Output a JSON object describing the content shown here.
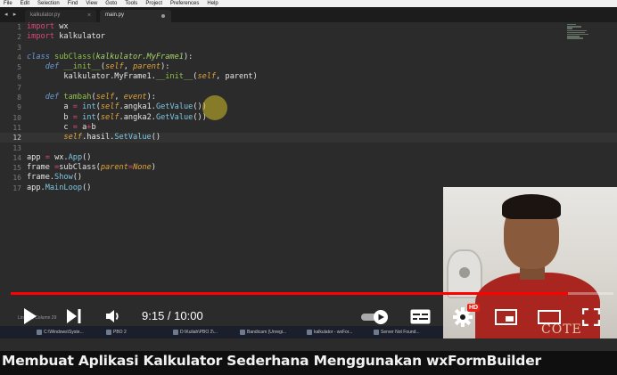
{
  "menu": [
    "File",
    "Edit",
    "Selection",
    "Find",
    "View",
    "Goto",
    "Tools",
    "Project",
    "Preferences",
    "Help"
  ],
  "tabs": [
    {
      "label": "kalkulator.py",
      "close": "×"
    },
    {
      "label": "main.py"
    }
  ],
  "nav_arrows": "◂ ▸",
  "line_numbers": [
    "1",
    "2",
    "3",
    "4",
    "5",
    "6",
    "7",
    "8",
    "9",
    "10",
    "11",
    "12",
    "13",
    "14",
    "15",
    "16",
    "17"
  ],
  "current_line": "12",
  "code": {
    "l1_kw": "import",
    "l1_rest": " wx",
    "l2_kw": "import",
    "l2_rest": " kalkulator",
    "l4_kw": "class",
    "l4_name": " subClass(",
    "l4_base": "kalkulator.MyFrame1",
    "l4_end": "):",
    "l5_indent": "    ",
    "l5_kw": "def",
    "l5_fn": " __init__",
    "l5_p1": "(",
    "l5_self": "self",
    "l5_comma": ", ",
    "l5_parent": "parent",
    "l5_end": "):",
    "l6_text": "        kalkulator.MyFrame1.",
    "l6_fn": "__init__",
    "l6_p1": "(",
    "l6_self": "self",
    "l6_end": ", parent)",
    "l8_indent": "    ",
    "l8_kw": "def",
    "l8_fn": " tambah",
    "l8_p1": "(",
    "l8_self": "self",
    "l8_comma": ", ",
    "l8_event": "event",
    "l8_end": "):",
    "l9_a": "        a ",
    "l9_eq": "=",
    "l9_sp": " ",
    "l9_int": "int",
    "l9_p": "(",
    "l9_self": "self",
    "l9_dot": ".angka1.",
    "l9_gv": "GetValue",
    "l9_end": "())",
    "l10_a": "        b ",
    "l10_eq": "=",
    "l10_sp": " ",
    "l10_int": "int",
    "l10_p": "(",
    "l10_self": "self",
    "l10_dot": ".angka2.",
    "l10_gv": "GetValue",
    "l10_end": "())",
    "l11_a": "        c ",
    "l11_eq": "=",
    "l11_sp": " a",
    "l11_plus": "+",
    "l11_end": "b",
    "l12_indent": "        ",
    "l12_self": "self",
    "l12_dot": ".hasil.",
    "l12_sv": "SetValue",
    "l12_end": "()",
    "l14_a": "app ",
    "l14_eq": "=",
    "l14_sp": " wx.",
    "l14_fn": "App",
    "l14_end": "()",
    "l15_a": "frame ",
    "l15_eq": "=",
    "l15_fn": "subClass",
    "l15_p": "(",
    "l15_kw": "parent",
    "l15_eq2": "=",
    "l15_none": "None",
    "l15_end": ")",
    "l16_a": "frame.",
    "l16_fn": "Show",
    "l16_end": "()",
    "l17_a": "app.",
    "l17_fn": "MainLoop",
    "l17_end": "()"
  },
  "statusbar": "Line 12, Column 29",
  "taskbar": [
    "C:\\Windows\\Syste...",
    "PBO 2",
    "D:\\Kuliah\\PBO 2\\...",
    "Bandicam (Unregi...",
    "kalkulator - wxFor...",
    "Server Not Found..."
  ],
  "webcam": {
    "shirt_text": "COTE"
  },
  "player": {
    "time": "9:15 / 10:00",
    "progress": 0.925,
    "hd_badge": "HD",
    "accent": "#ff0000"
  },
  "title": "Membuat Aplikasi Kalkulator Sederhana Menggunakan wxFormBuilder"
}
